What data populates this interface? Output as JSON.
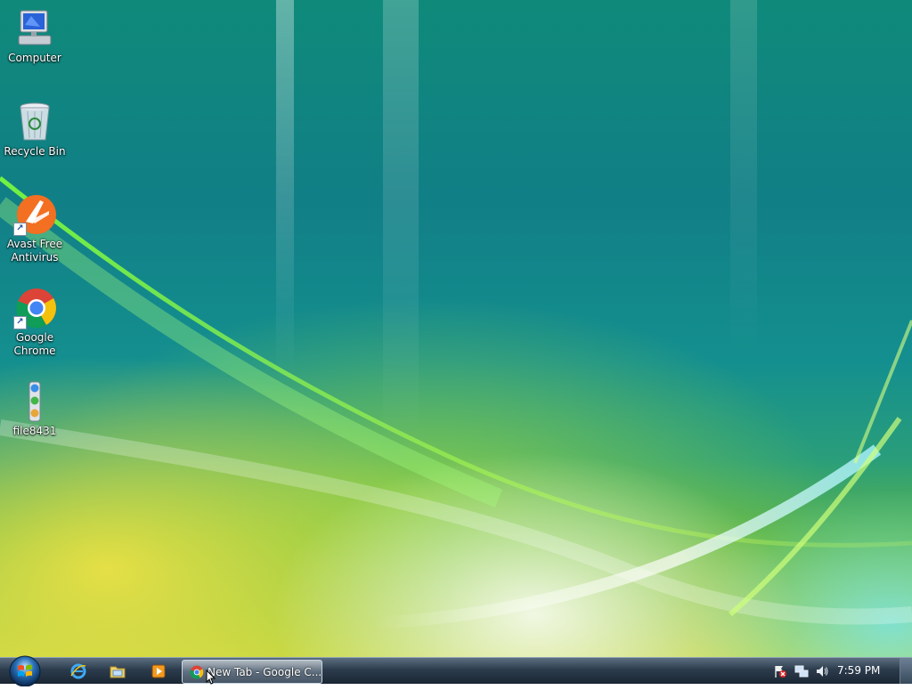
{
  "desktop": {
    "icons": [
      {
        "label": "Computer",
        "icon": "computer-icon"
      },
      {
        "label": "Recycle Bin",
        "icon": "recycle-bin-icon"
      },
      {
        "label": "Avast Free\nAntivirus",
        "icon": "avast-icon"
      },
      {
        "label": "Google\nChrome",
        "icon": "chrome-icon"
      },
      {
        "label": "file8431",
        "icon": "file-icon"
      }
    ]
  },
  "taskbar": {
    "start_icon": "windows-orb-icon",
    "quick_launch": [
      "internet-explorer-icon",
      "windows-explorer-icon",
      "media-player-icon"
    ],
    "task_button": {
      "label": "New Tab - Google C...",
      "icon": "chrome-icon"
    },
    "tray": {
      "icons": [
        "action-center-flag-icon",
        "network-icon",
        "volume-icon"
      ],
      "clock": "7:59 PM"
    }
  },
  "colors": {
    "taskbar": "#2c3c4d",
    "desktop_teal": "#117f86",
    "desktop_yellow": "#ebe146"
  }
}
